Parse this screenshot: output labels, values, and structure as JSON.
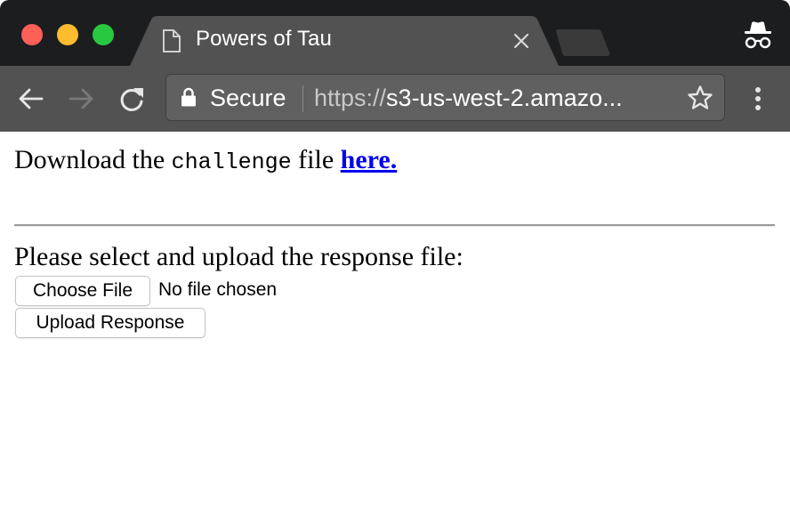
{
  "window": {
    "traffic_lights": {
      "close_color": "#fe5f57",
      "minimize_color": "#febc2e",
      "zoom_color": "#28c840"
    }
  },
  "tabs": [
    {
      "title": "Powers of Tau",
      "icon": "document-icon",
      "active": true
    }
  ],
  "toolbar": {
    "icons": {
      "back": "arrow-left-icon",
      "forward": "arrow-right-icon",
      "reload": "reload-icon",
      "bookmark": "star-icon",
      "menu": "vertical-dots-icon",
      "incognito": "incognito-icon"
    },
    "omnibox": {
      "security_label": "Secure",
      "url_scheme": "https://",
      "url_rest": "s3-us-west-2.amazo..."
    }
  },
  "page": {
    "download": {
      "text_before": "Download the ",
      "code": "challenge",
      "text_after": " file ",
      "link_label": "here.",
      "link_color": "#0000ee"
    },
    "upload": {
      "prompt": "Please select and upload the response file:",
      "choose_file_label": "Choose File",
      "file_status": "No file chosen",
      "upload_label": "Upload Response"
    }
  }
}
